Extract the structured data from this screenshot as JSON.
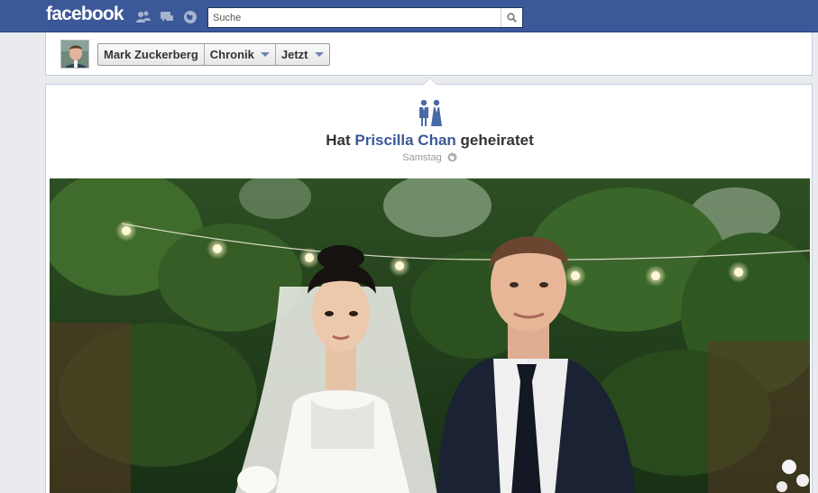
{
  "header": {
    "logo": "facebook",
    "search": {
      "placeholder": "Suche",
      "value": ""
    },
    "jewels": [
      "friend-requests-icon",
      "messages-icon",
      "notifications-icon"
    ]
  },
  "timeline_nav": {
    "name": "Mark Zuckerberg",
    "section": "Chronik",
    "period": "Jetzt"
  },
  "story": {
    "icon": "married-couple-icon",
    "prefix": "Hat",
    "person": "Priscilla Chan",
    "suffix": "geheiratet",
    "timestamp": "Samstag",
    "audience_icon": "globe-icon"
  },
  "colors": {
    "brand": "#3b5998",
    "link": "#3b5998",
    "page_bg": "#e9ebee"
  }
}
